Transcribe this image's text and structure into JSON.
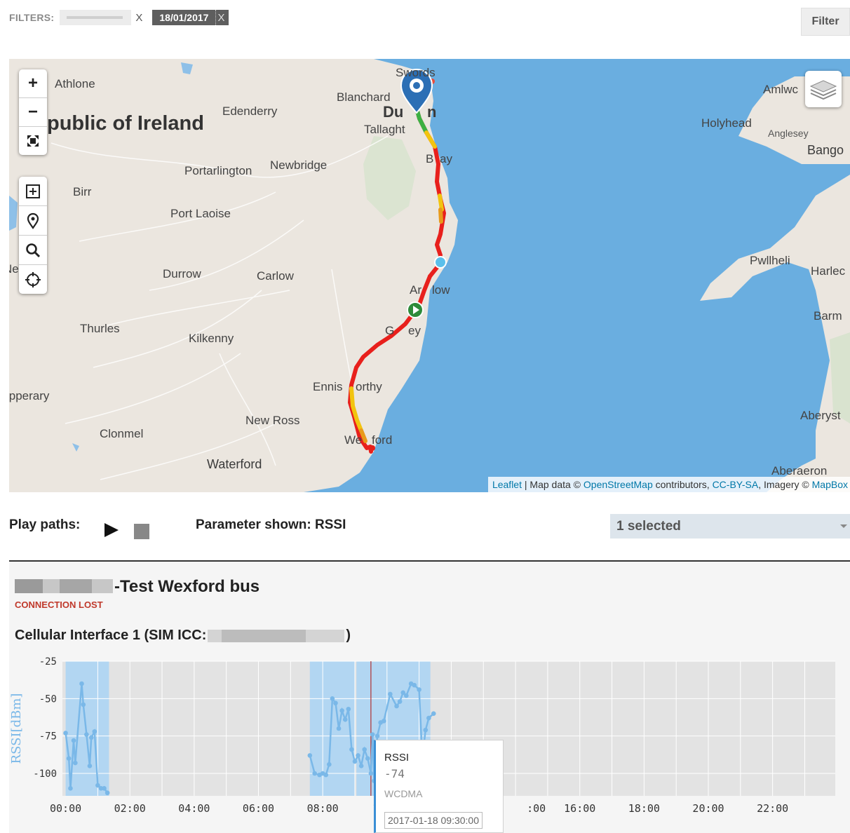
{
  "filters": {
    "label": "FILTERS:",
    "chip1_remove": "X",
    "date_chip": "18/01/2017",
    "date_remove": "X",
    "filter_button": "Filter"
  },
  "map": {
    "labels": {
      "athlone": "Athlone",
      "republic": "public of Ireland",
      "edenderry": "Edenderry",
      "swords": "Swords",
      "blanchard": "Blanchard",
      "dublin": "Du",
      "dublin2": "n",
      "tallaght": "Tallaght",
      "bray": "B",
      "bray2": "ay",
      "portarlington": "Portarlington",
      "newbridge": "Newbridge",
      "birr": "Birr",
      "portlaoise": "Port Laoise",
      "durrow": "Durrow",
      "carlow": "Carlow",
      "arklow": "Ar",
      "arklow2": "low",
      "gorey": "G",
      "gorey2": "ey",
      "thurles": "Thurles",
      "kilkenny": "Kilkenny",
      "enniscorthy": "Ennis",
      "enniscorthy2": "orthy",
      "tipperary": "ipperary",
      "newross": "New Ross",
      "clonmel": "Clonmel",
      "wexford": "We",
      "wexford2": "ford",
      "waterford": "Waterford",
      "amlwch": "Amlwc",
      "holyhead": "Holyhead",
      "anglesey": "Anglesey",
      "bangor": "Bango",
      "pwllheli": "Pwllheli",
      "harlech": "Harlec",
      "barmouth": "Barm",
      "aberystwyth": "Aberyst",
      "aberaeron": "Aberaeron",
      "ne": "Ne"
    },
    "zoom_in": "+",
    "zoom_out": "−",
    "attribution": {
      "leaflet": "Leaflet",
      "sep": " | Map data © ",
      "osm": "OpenStreetMap",
      "contrib": " contributors, ",
      "license": "CC-BY-SA",
      "imagery": ", Imagery © ",
      "mapbox": "MapBox"
    }
  },
  "controls": {
    "play_label": "Play paths:",
    "parameter_label": "Parameter shown: RSSI",
    "select_value": "1 selected"
  },
  "device": {
    "title": "-Test Wexford bus",
    "status": "CONNECTION LOST",
    "interface_prefix": "Cellular Interface 1 (SIM ICC:",
    "interface_suffix": ")"
  },
  "tooltip": {
    "title": "RSSI",
    "value": "-74",
    "tech": "WCDMA",
    "time": "2017-01-18 09:30:00"
  },
  "colors": {
    "path_good": "#3cb043",
    "path_mid": "#f2c40f",
    "path_bad": "#e8201c",
    "series": "#7ab8e8",
    "highlight": "#a9d3f5"
  },
  "chart_data": {
    "type": "line",
    "ylabel": "RSSI[dBm]",
    "ylim": [
      -115,
      -25
    ],
    "yticks": [
      "-25",
      "-50",
      "-75",
      "-100"
    ],
    "xticks": [
      "00:00",
      "02:00",
      "04:00",
      "06:00",
      "08:00",
      "1",
      ":00",
      "16:00",
      "18:00",
      "20:00",
      "22:00"
    ],
    "x_hours_range": [
      -0.1,
      23.95
    ],
    "highlight_ranges": [
      [
        0.0,
        1.35
      ],
      [
        7.6,
        9.0
      ],
      [
        9.05,
        11.35
      ]
    ],
    "cursor_hour": 9.5,
    "points": [
      [
        0.0,
        -73
      ],
      [
        0.1,
        -90
      ],
      [
        0.15,
        -110
      ],
      [
        0.25,
        -78
      ],
      [
        0.3,
        -93
      ],
      [
        0.5,
        -40
      ],
      [
        0.55,
        -54
      ],
      [
        0.65,
        -74
      ],
      [
        0.75,
        -95
      ],
      [
        0.8,
        -76
      ],
      [
        0.9,
        -72
      ],
      [
        1.0,
        -108
      ],
      [
        1.1,
        -110
      ],
      [
        1.2,
        -110
      ],
      [
        1.3,
        -113
      ],
      [
        7.6,
        -88
      ],
      [
        7.75,
        -100
      ],
      [
        7.9,
        -101
      ],
      [
        8.0,
        -100
      ],
      [
        8.1,
        -101
      ],
      [
        8.2,
        -94
      ],
      [
        8.3,
        -50
      ],
      [
        8.4,
        -53
      ],
      [
        8.5,
        -70
      ],
      [
        8.6,
        -58
      ],
      [
        8.7,
        -64
      ],
      [
        8.8,
        -57
      ],
      [
        8.9,
        -84
      ],
      [
        9.0,
        -92
      ],
      [
        9.1,
        -88
      ],
      [
        9.2,
        -95
      ],
      [
        9.3,
        -84
      ],
      [
        9.4,
        -90
      ],
      [
        9.5,
        -100
      ],
      [
        9.55,
        -74
      ],
      [
        9.6,
        -105
      ],
      [
        9.7,
        -75
      ],
      [
        9.8,
        -66
      ],
      [
        9.9,
        -65
      ],
      [
        10.1,
        -47
      ],
      [
        10.3,
        -55
      ],
      [
        10.4,
        -52
      ],
      [
        10.5,
        -46
      ],
      [
        10.6,
        -48
      ],
      [
        10.75,
        -40
      ],
      [
        10.85,
        -41
      ],
      [
        11.0,
        -44
      ],
      [
        11.1,
        -90
      ],
      [
        11.2,
        -71
      ],
      [
        11.3,
        -63
      ],
      [
        11.45,
        -60
      ]
    ]
  }
}
